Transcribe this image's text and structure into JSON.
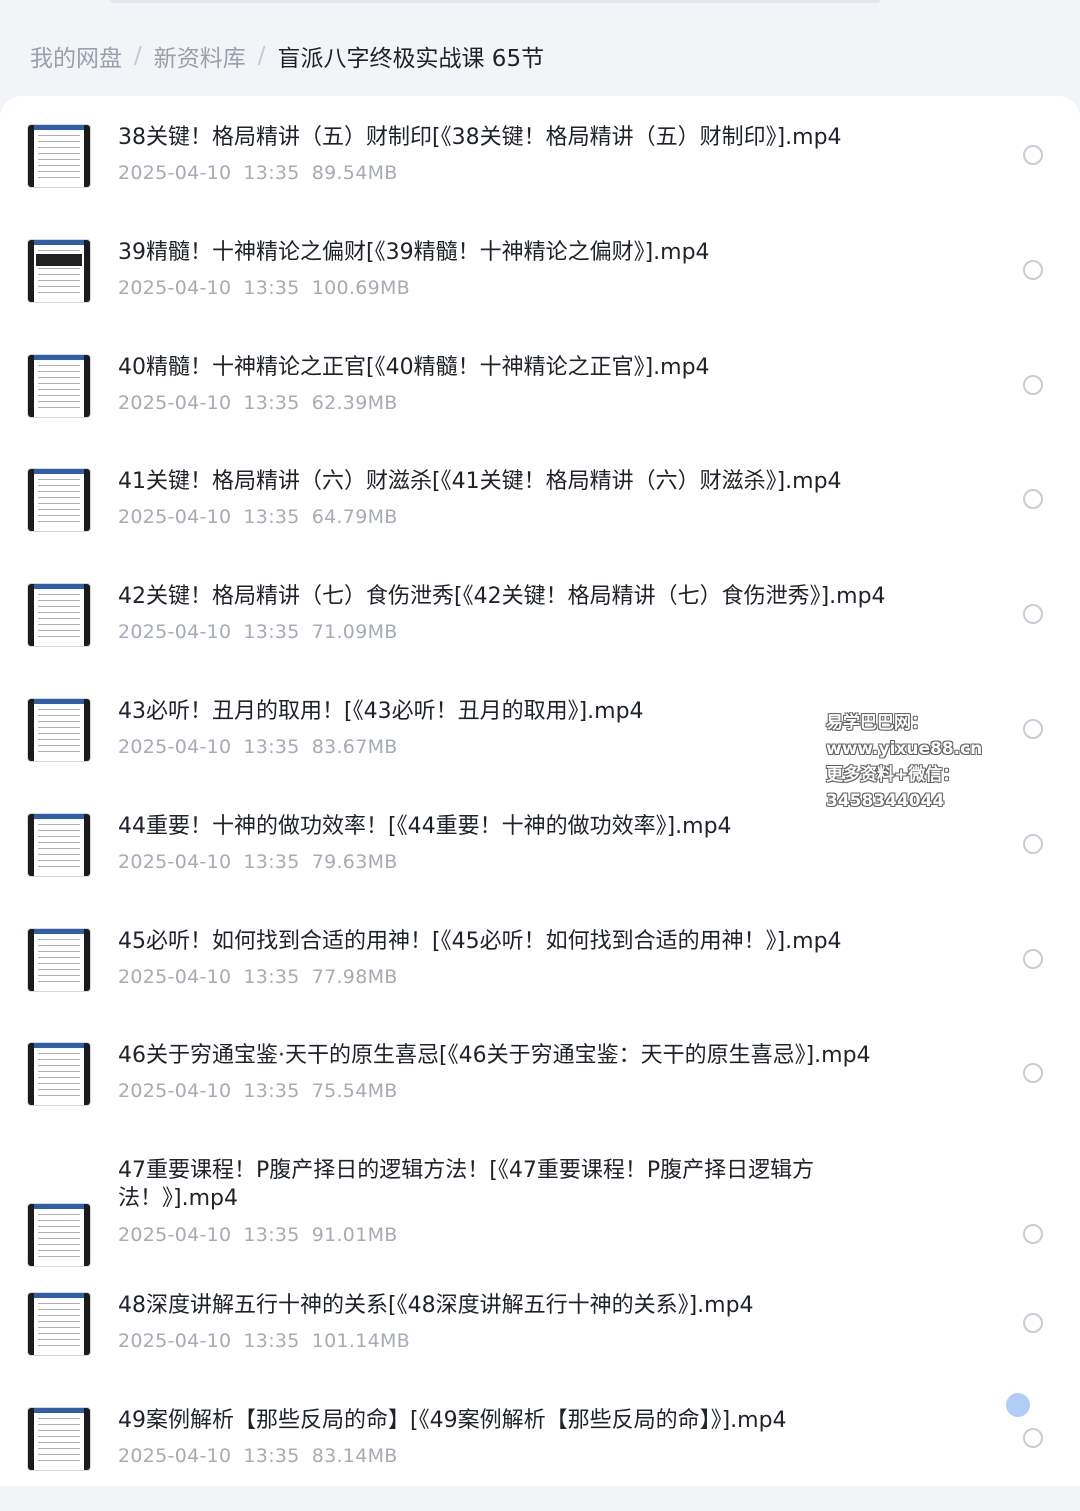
{
  "breadcrumb": {
    "items": [
      "我的网盘",
      "新资料库"
    ],
    "current": "盲派八字终极实战课 65节",
    "separator": "/"
  },
  "files": [
    {
      "title": "38关键！格局精讲（五）财制印[《38关键！格局精讲（五）财制印》].mp4",
      "date": "2025-04-10",
      "time": "13:35",
      "size": "89.54MB"
    },
    {
      "title": "39精髓！十神精论之偏财[《39精髓！十神精论之偏财》].mp4",
      "date": "2025-04-10",
      "time": "13:35",
      "size": "100.69MB"
    },
    {
      "title": "40精髓！十神精论之正官[《40精髓！十神精论之正官》].mp4",
      "date": "2025-04-10",
      "time": "13:35",
      "size": "62.39MB"
    },
    {
      "title": "41关键！格局精讲（六）财滋杀[《41关键！格局精讲（六）财滋杀》].mp4",
      "date": "2025-04-10",
      "time": "13:35",
      "size": "64.79MB"
    },
    {
      "title": "42关键！格局精讲（七）食伤泄秀[《42关键！格局精讲（七）食伤泄秀》].mp4",
      "date": "2025-04-10",
      "time": "13:35",
      "size": "71.09MB"
    },
    {
      "title": "43必听！丑月的取用！[《43必听！丑月的取用》].mp4",
      "date": "2025-04-10",
      "time": "13:35",
      "size": "83.67MB"
    },
    {
      "title": "44重要！十神的做功效率！[《44重要！十神的做功效率》].mp4",
      "date": "2025-04-10",
      "time": "13:35",
      "size": "79.63MB"
    },
    {
      "title": "45必听！如何找到合适的用神！[《45必听！如何找到合适的用神！》].mp4",
      "date": "2025-04-10",
      "time": "13:35",
      "size": "77.98MB"
    },
    {
      "title": "46关于穷通宝鉴·天干的原生喜忌[《46关于穷通宝鉴：天干的原生喜忌》].mp4",
      "date": "2025-04-10",
      "time": "13:35",
      "size": "75.54MB"
    },
    {
      "title": "47重要课程！P腹产择日的逻辑方法！[《47重要课程！P腹产择日逻辑方法！》].mp4",
      "date": "2025-04-10",
      "time": "13:35",
      "size": "91.01MB"
    },
    {
      "title": "48深度讲解五行十神的关系[《48深度讲解五行十神的关系》].mp4",
      "date": "2025-04-10",
      "time": "13:35",
      "size": "101.14MB"
    },
    {
      "title": "49案例解析【那些反局的命】[《49案例解析【那些反局的命】》].mp4",
      "date": "2025-04-10",
      "time": "13:35",
      "size": "83.14MB"
    }
  ],
  "watermark": {
    "line1": "易学巴巴网：www.yixue88.cn",
    "line2": "更多资料+微信：3458344044"
  }
}
